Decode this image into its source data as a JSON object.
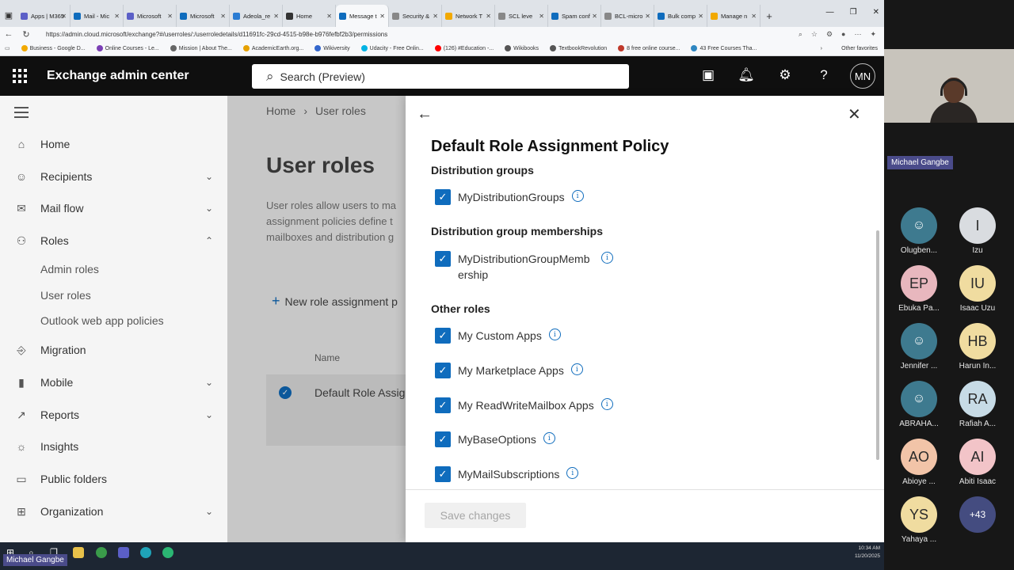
{
  "browser": {
    "tabs": [
      {
        "label": "Apps | M365",
        "color": "#5b5fc7"
      },
      {
        "label": "Mail - Mic",
        "color": "#0f6cbd"
      },
      {
        "label": "Microsoft",
        "color": "#5b5fc7"
      },
      {
        "label": "Microsoft",
        "color": "#0f6cbd"
      },
      {
        "label": "Adeola_re",
        "color": "#2b7cd3"
      },
      {
        "label": "Home",
        "color": "#333333"
      },
      {
        "label": "Message t",
        "color": "#0f6cbd",
        "active": true
      },
      {
        "label": "Security &",
        "color": "#888888"
      },
      {
        "label": "Network T",
        "color": "#f2a900"
      },
      {
        "label": "SCL leve",
        "color": "#888888"
      },
      {
        "label": "Spam conf",
        "color": "#0f6cbd"
      },
      {
        "label": "BCL-micro",
        "color": "#888888"
      },
      {
        "label": "Bulk comp",
        "color": "#0f6cbd"
      },
      {
        "label": "Manage n",
        "color": "#f2a900"
      }
    ],
    "url": "https://admin.cloud.microsoft/exchange?#/userroles/:/userroledetails/d11691fc-29cd-4515-b98e-b976fefbf2b3/permissions",
    "favorites": [
      {
        "label": "Business - Google D...",
        "color": "#f2a900"
      },
      {
        "label": "Online Courses - Le...",
        "color": "#7b3fb5"
      },
      {
        "label": "Mission | About The...",
        "color": "#666666"
      },
      {
        "label": "AcademicEarth.org...",
        "color": "#e6a100"
      },
      {
        "label": "Wikiversity",
        "color": "#3366cc"
      },
      {
        "label": "Udacity - Free Onlin...",
        "color": "#02b3e4"
      },
      {
        "label": "(126) #Education -...",
        "color": "#ff0000"
      },
      {
        "label": "Wikibooks",
        "color": "#555555"
      },
      {
        "label": "TextbookRevolution",
        "color": "#555555"
      },
      {
        "label": "8 free online course...",
        "color": "#c0392b"
      },
      {
        "label": "43 Free Courses Tha...",
        "color": "#2e86c1"
      }
    ],
    "other_favorites": "Other favorites"
  },
  "header": {
    "app_title": "Exchange admin center",
    "search_placeholder": "Search (Preview)",
    "avatar_initials": "MN"
  },
  "nav": {
    "items": [
      {
        "label": "Home",
        "icon": "⌂",
        "chevron": ""
      },
      {
        "label": "Recipients",
        "icon": "☺",
        "chevron": "⌄"
      },
      {
        "label": "Mail flow",
        "icon": "✉",
        "chevron": "⌄"
      },
      {
        "label": "Roles",
        "icon": "⚇",
        "chevron": "⌃"
      },
      {
        "label": "Migration",
        "icon": "⎆",
        "chevron": ""
      },
      {
        "label": "Mobile",
        "icon": "▮",
        "chevron": "⌄"
      },
      {
        "label": "Reports",
        "icon": "↗",
        "chevron": "⌄"
      },
      {
        "label": "Insights",
        "icon": "☼",
        "chevron": ""
      },
      {
        "label": "Public folders",
        "icon": "▭",
        "chevron": ""
      },
      {
        "label": "Organization",
        "icon": "⊞",
        "chevron": "⌄"
      }
    ],
    "roles_sub": [
      "Admin roles",
      "User roles",
      "Outlook web app policies"
    ]
  },
  "main": {
    "breadcrumb": [
      "Home",
      "User roles"
    ],
    "title": "User roles",
    "description": "User roles allow users to ma assignment policies define t mailboxes and distribution g",
    "new_button": "New role assignment p",
    "column_name": "Name",
    "row_name": "Default Role Assig"
  },
  "panel": {
    "title": "Default Role Assignment Policy",
    "sections": [
      {
        "heading": "Distribution groups",
        "items": [
          "MyDistributionGroups"
        ]
      },
      {
        "heading": "Distribution group memberships",
        "items": [
          "MyDistributionGroupMembership"
        ]
      },
      {
        "heading": "Other roles",
        "items": [
          "My Custom Apps",
          "My Marketplace Apps",
          "My ReadWriteMailbox Apps",
          "MyBaseOptions",
          "MyMailSubscriptions"
        ]
      }
    ],
    "save_label": "Save changes"
  },
  "taskbar": {
    "time": "10:34 AM",
    "date": "11/20/2025",
    "presenter": "Michael Gangbe"
  },
  "meeting": {
    "video_name": "Michael Gangbe",
    "participants": [
      {
        "initials": "",
        "name": "Olugben...",
        "bg": "#3e7a8f"
      },
      {
        "initials": "I",
        "name": "Izu",
        "bg": "#d9dce0"
      },
      {
        "initials": "EP",
        "name": "Ebuka Pa...",
        "bg": "#e8b7be"
      },
      {
        "initials": "IU",
        "name": "Isaac Uzu",
        "bg": "#f0dca0"
      },
      {
        "initials": "",
        "name": "Jennifer ...",
        "bg": "#3e7a8f"
      },
      {
        "initials": "HB",
        "name": "Harun In...",
        "bg": "#f0dca0"
      },
      {
        "initials": "",
        "name": "ABRAHA...",
        "bg": "#3e7a8f"
      },
      {
        "initials": "RA",
        "name": "Rafiah A...",
        "bg": "#c7dbe6"
      },
      {
        "initials": "AO",
        "name": "Abioye ...",
        "bg": "#f2c4a8"
      },
      {
        "initials": "AI",
        "name": "Abiti Isaac",
        "bg": "#f2c4c8"
      },
      {
        "initials": "YS",
        "name": "Yahaya ...",
        "bg": "#f0dca0"
      },
      {
        "initials": "+43",
        "name": "",
        "bg": "#444c80"
      }
    ]
  }
}
